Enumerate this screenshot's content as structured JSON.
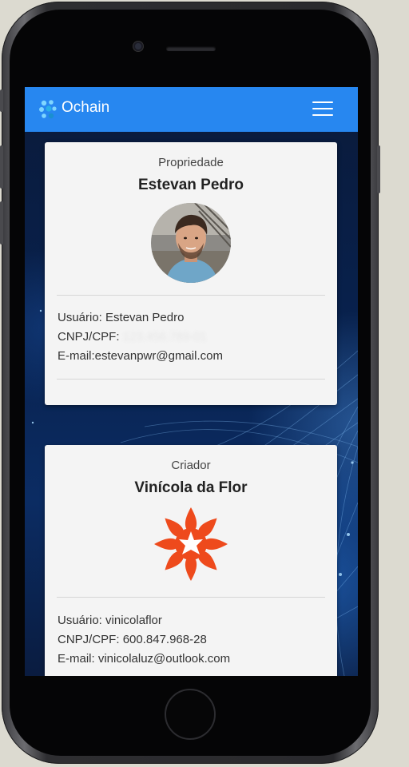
{
  "app": {
    "title": "Ochain",
    "brand_color": "#2787f0",
    "logo_icon": "ochain-logo-icon",
    "menu_icon": "hamburger-menu-icon"
  },
  "cards": [
    {
      "role": "Propriedade",
      "name": "Estevan Pedro",
      "image": "profile-photo",
      "user_label": "Usuário:",
      "user_value": "Estevan Pedro",
      "doc_label": "CNPJ/CPF:",
      "doc_value": "",
      "email_label": "E-mail:",
      "email_value": "estevanpwr@gmail.com"
    },
    {
      "role": "Criador",
      "name": "Vinícola da Flor",
      "image": "flower-logo",
      "image_color": "#ee4a1c",
      "user_label": "Usuário:",
      "user_value": "vinicolaflor",
      "doc_label": "CNPJ/CPF:",
      "doc_value": "600.847.968-28",
      "email_label": "E-mail:",
      "email_value": "vinicolaluz@outlook.com"
    }
  ]
}
